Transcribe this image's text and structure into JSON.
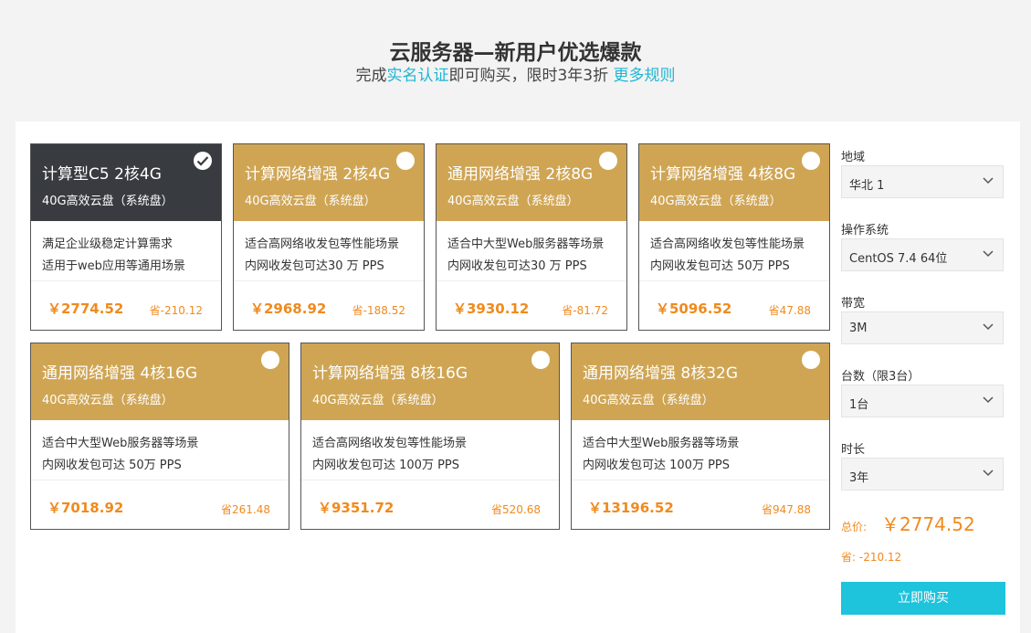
{
  "header": {
    "title": "云服务器—新用户优选爆款",
    "subtitle_prefix": "完成",
    "subtitle_link": "实名认证",
    "subtitle_middle": "即可购买，限时3年3折 ",
    "more_rules": "更多规则"
  },
  "cards": [
    {
      "name": "计算型C5 2核4G",
      "disk": "40G高效云盘（系统盘）",
      "desc1": "满足企业级稳定计算需求",
      "desc2": "适用于web应用等通用场景",
      "price": "￥2774.52",
      "save": "省-210.12",
      "selected": true
    },
    {
      "name": "计算网络增强 2核4G",
      "disk": "40G高效云盘（系统盘）",
      "desc1": "适合高网络收发包等性能场景",
      "desc2": "内网收发包可达30 万 PPS",
      "price": "￥2968.92",
      "save": "省-188.52",
      "selected": false
    },
    {
      "name": "通用网络增强 2核8G",
      "disk": "40G高效云盘（系统盘）",
      "desc1": "适合中大型Web服务器等场景",
      "desc2": "内网收发包可达30 万 PPS",
      "price": "￥3930.12",
      "save": "省-81.72",
      "selected": false
    },
    {
      "name": "计算网络增强 4核8G",
      "disk": "40G高效云盘（系统盘）",
      "desc1": "适合高网络收发包等性能场景",
      "desc2": "内网收发包可达 50万 PPS",
      "price": "￥5096.52",
      "save": "省47.88",
      "selected": false
    },
    {
      "name": "通用网络增强 4核16G",
      "disk": "40G高效云盘（系统盘）",
      "desc1": "适合中大型Web服务器等场景",
      "desc2": "内网收发包可达 50万 PPS",
      "price": "￥7018.92",
      "save": "省261.48",
      "selected": false
    },
    {
      "name": "计算网络增强 8核16G",
      "disk": "40G高效云盘（系统盘）",
      "desc1": "适合高网络收发包等性能场景",
      "desc2": "内网收发包可达 100万 PPS",
      "price": "￥9351.72",
      "save": "省520.68",
      "selected": false
    },
    {
      "name": "通用网络增强 8核32G",
      "disk": "40G高效云盘（系统盘）",
      "desc1": "适合中大型Web服务器等场景",
      "desc2": "内网收发包可达 100万 PPS",
      "price": "￥13196.52",
      "save": "省947.88",
      "selected": false
    }
  ],
  "sidebar": {
    "region_label": "地域",
    "region_value": "华北 1",
    "os_label": "操作系统",
    "os_value": "CentOS 7.4 64位",
    "bandwidth_label": "带宽",
    "bandwidth_value": "3M",
    "count_label": "台数（限3台）",
    "count_value": "1台",
    "duration_label": "时长",
    "duration_value": "3年",
    "total_label": "总价:",
    "total_value": "￥2774.52",
    "save_label": "省: -210.12",
    "buy_label": "立即购买"
  },
  "colors": {
    "gold": "#cfa554",
    "dark": "#383b40",
    "accent": "#1ec3dc",
    "price": "#f08a1e"
  }
}
